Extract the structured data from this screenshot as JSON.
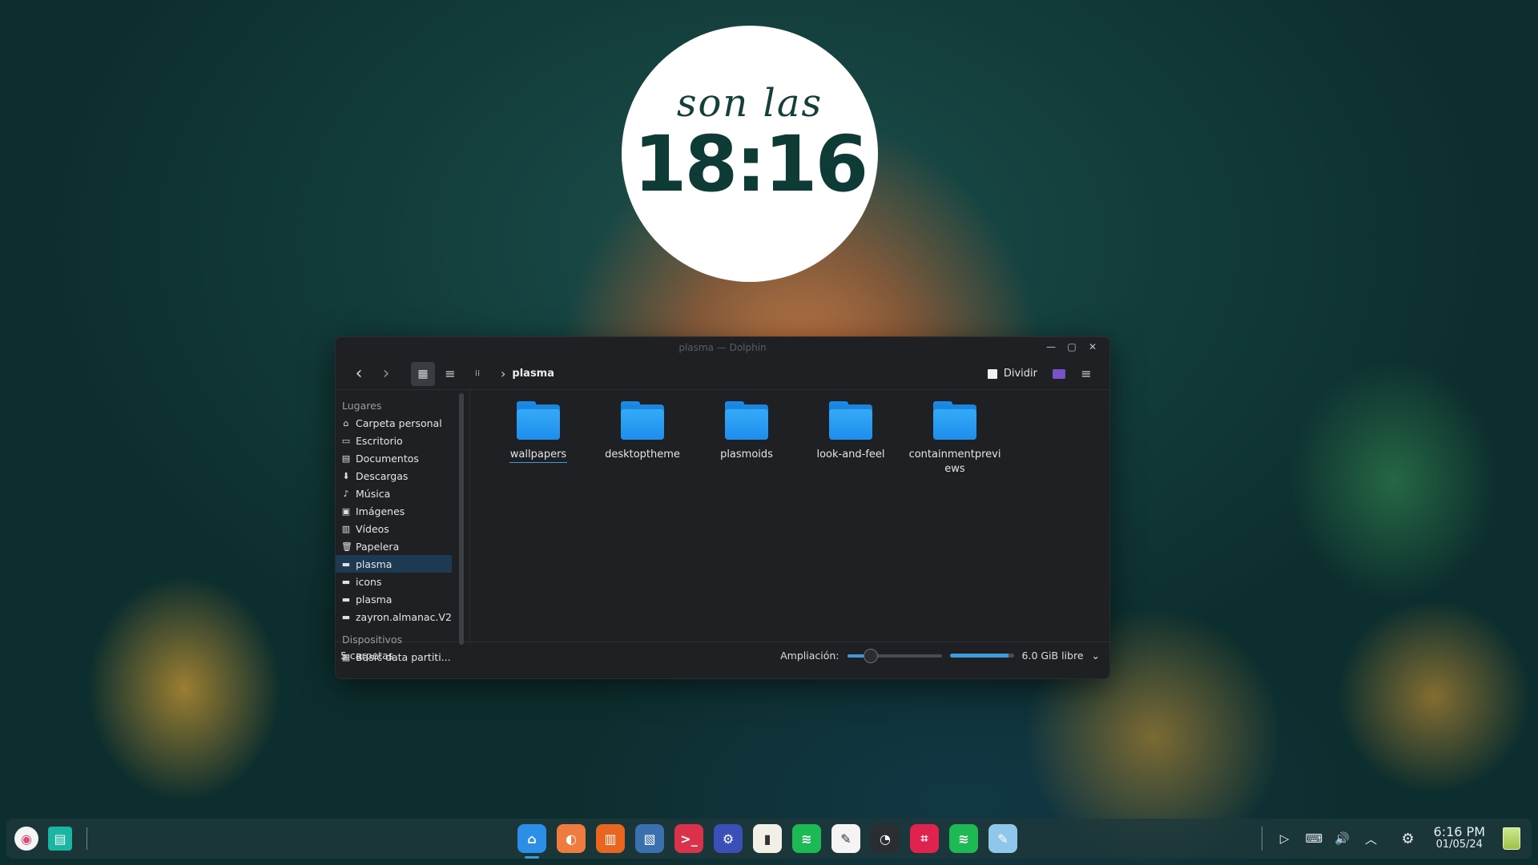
{
  "clock": {
    "prefix": "son las",
    "time": "18:16"
  },
  "window": {
    "title": "plasma — Dolphin",
    "controls": {
      "minimize": "—",
      "maximize": "▢",
      "close": "✕"
    },
    "toolbar": {
      "back_icon": "‹",
      "forward_icon": "›",
      "view_icons": "▦",
      "view_compact": "≡",
      "view_details": "⁞⁞",
      "breadcrumb_sep": "›",
      "breadcrumb_current": "plasma",
      "split_label": "Dividir",
      "menu_icon": "≡"
    },
    "places": {
      "section_places": "Lugares",
      "items": [
        {
          "icon": "⌂",
          "label": "Carpeta personal"
        },
        {
          "icon": "▭",
          "label": "Escritorio"
        },
        {
          "icon": "▤",
          "label": "Documentos"
        },
        {
          "icon": "⬇",
          "label": "Descargas"
        },
        {
          "icon": "♪",
          "label": "Música"
        },
        {
          "icon": "▣",
          "label": "Imágenes"
        },
        {
          "icon": "▥",
          "label": "Vídeos"
        },
        {
          "icon": "🗑",
          "label": "Papelera"
        },
        {
          "icon": "▬",
          "label": "plasma",
          "selected": true
        },
        {
          "icon": "▬",
          "label": "icons"
        },
        {
          "icon": "▬",
          "label": "plasma"
        },
        {
          "icon": "▬",
          "label": "zayron.almanac.V2"
        }
      ],
      "section_devices": "Dispositivos",
      "device": {
        "icon": "▦",
        "label": "Basic data partiti..."
      }
    },
    "files": [
      {
        "name": "wallpapers",
        "focused": true
      },
      {
        "name": "desktoptheme"
      },
      {
        "name": "plasmoids"
      },
      {
        "name": "look-and-feel"
      },
      {
        "name": "containmentpreviews"
      }
    ],
    "status": {
      "count": "5 carpetas",
      "zoom_label": "Ampliación:",
      "zoom_level": 0.25,
      "free_space": "6.0 GiB libre",
      "used_fraction": 0.92,
      "dropdown_icon": "⌄"
    }
  },
  "taskbar": {
    "launcher_icon": "◉",
    "overview_icon": "▤",
    "apps": [
      {
        "name": "Dolphin",
        "color": "#2b8fe8",
        "glyph": "⌂",
        "active": true
      },
      {
        "name": "Firefox",
        "color": "#f07b3f",
        "glyph": "◐"
      },
      {
        "name": "Archive",
        "color": "#e8661f",
        "glyph": "▥"
      },
      {
        "name": "Image viewer",
        "color": "#3a6fb0",
        "glyph": "▧"
      },
      {
        "name": "Terminal",
        "color": "#d9324a",
        "glyph": ">_"
      },
      {
        "name": "Settings",
        "color": "#3b4fb8",
        "glyph": "⚙"
      },
      {
        "name": "Notes",
        "color": "#f2efe6",
        "glyph": "▮"
      },
      {
        "name": "Spotify",
        "color": "#1db954",
        "glyph": "≋"
      },
      {
        "name": "Inkscape",
        "color": "#f4f4f4",
        "glyph": "✎"
      },
      {
        "name": "Game",
        "color": "#2a2e33",
        "glyph": "◔"
      },
      {
        "name": "Crop",
        "color": "#e0234e",
        "glyph": "⌗"
      },
      {
        "name": "Spotify 2",
        "color": "#1db954",
        "glyph": "≋"
      },
      {
        "name": "Text editor",
        "color": "#8fc7ea",
        "glyph": "✎"
      }
    ],
    "tray": {
      "media_icon": "▷",
      "keyboard_icon": "⌨",
      "volume_icon": "🔊",
      "expand_icon": "︿",
      "settings_icon": "⚙",
      "time": "6:16 PM",
      "date": "01/05/24",
      "trash_icon": "▯"
    }
  }
}
